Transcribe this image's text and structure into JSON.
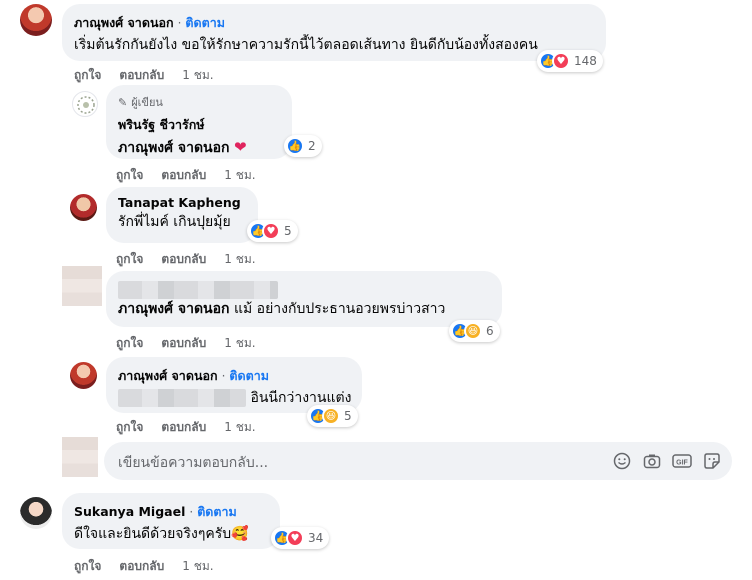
{
  "comments": [
    {
      "name": "ภาณุพงศ์ จาดนอก",
      "follow": "ติดตาม",
      "text": "เริ่มต้นรักกันยังไง ขอให้รักษาความรักนี้ไว้ตลอดเส้นทาง ยินดีกับน้องทั้งสองคน",
      "reaction_count": "148",
      "like_label": "ถูกใจ",
      "reply_label": "ตอบกลับ",
      "time": "1 ชม."
    },
    {
      "badge": "ผู้เขียน",
      "name": "พรินรัฐ ชีวารักษ์",
      "tag": "ภาณุพงศ์ จาดนอก",
      "reaction_count": "2",
      "like_label": "ถูกใจ",
      "reply_label": "ตอบกลับ",
      "time": "1 ชม."
    },
    {
      "name": "Tanapat Kapheng",
      "text": "รักพี่ไมค์ เกินปุยมุ้ย",
      "reaction_count": "5",
      "like_label": "ถูกใจ",
      "reply_label": "ตอบกลับ",
      "time": "1 ชม."
    },
    {
      "tag": "ภาณุพงศ์ จาดนอก",
      "text": "แม้ อย่างกับประธานอวยพรบ่าวสาว",
      "reaction_count": "6",
      "like_label": "ถูกใจ",
      "reply_label": "ตอบกลับ",
      "time": "1 ชม."
    },
    {
      "name": "ภาณุพงศ์ จาดนอก",
      "follow": "ติดตาม",
      "text": "อินนีกว่างานแต่ง",
      "reaction_count": "5",
      "like_label": "ถูกใจ",
      "reply_label": "ตอบกลับ",
      "time": "1 ชม."
    },
    {
      "name": "Sukanya Migael",
      "follow": "ติดตาม",
      "text": "ดีใจและยินดีด้วยจริงๆครับ🥰",
      "reaction_count": "34",
      "like_label": "ถูกใจ",
      "reply_label": "ตอบกลับ",
      "time": "1 ชม."
    }
  ],
  "reply_box": {
    "placeholder": "เขียนข้อความตอบกลับ...",
    "icons": [
      "emoji-icon",
      "camera-icon",
      "gif-icon",
      "sticker-icon"
    ]
  },
  "colors": {
    "link": "#1877f2",
    "bubble": "#f0f2f5",
    "meta": "#65676b"
  }
}
